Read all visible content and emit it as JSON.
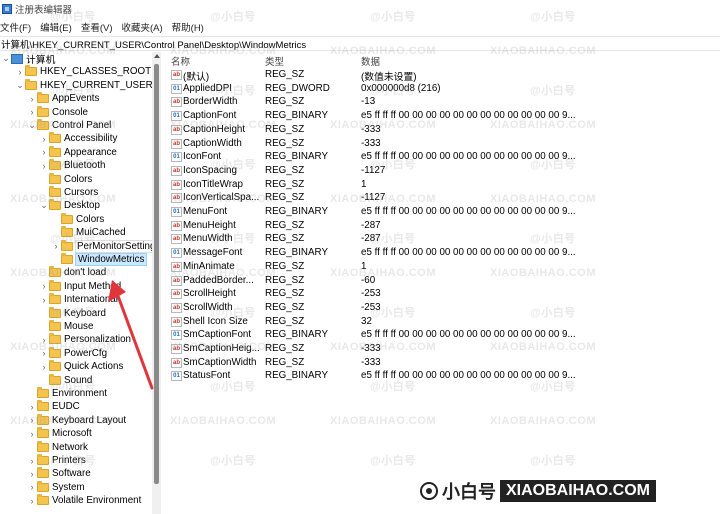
{
  "window": {
    "title": "注册表编辑器"
  },
  "menu": [
    "文件(F)",
    "编辑(E)",
    "查看(V)",
    "收藏夹(A)",
    "帮助(H)"
  ],
  "address": "计算机\\HKEY_CURRENT_USER\\Control Panel\\Desktop\\WindowMetrics",
  "tree": [
    {
      "label": "计算机",
      "indent": 0,
      "chev": "⌄",
      "icon": "computer"
    },
    {
      "label": "HKEY_CLASSES_ROOT",
      "indent": 1,
      "chev": "›",
      "icon": "folder"
    },
    {
      "label": "HKEY_CURRENT_USER",
      "indent": 1,
      "chev": "⌄",
      "icon": "folder"
    },
    {
      "label": "AppEvents",
      "indent": 2,
      "chev": "›",
      "icon": "folder"
    },
    {
      "label": "Console",
      "indent": 2,
      "chev": "›",
      "icon": "folder"
    },
    {
      "label": "Control Panel",
      "indent": 2,
      "chev": "⌄",
      "icon": "folder"
    },
    {
      "label": "Accessibility",
      "indent": 3,
      "chev": "›",
      "icon": "folder"
    },
    {
      "label": "Appearance",
      "indent": 3,
      "chev": "›",
      "icon": "folder"
    },
    {
      "label": "Bluetooth",
      "indent": 3,
      "chev": "›",
      "icon": "folder"
    },
    {
      "label": "Colors",
      "indent": 3,
      "chev": "",
      "icon": "folder"
    },
    {
      "label": "Cursors",
      "indent": 3,
      "chev": "",
      "icon": "folder"
    },
    {
      "label": "Desktop",
      "indent": 3,
      "chev": "⌄",
      "icon": "folder"
    },
    {
      "label": "Colors",
      "indent": 4,
      "chev": "",
      "icon": "folder"
    },
    {
      "label": "MuiCached",
      "indent": 4,
      "chev": "",
      "icon": "folder"
    },
    {
      "label": "PerMonitorSettings",
      "indent": 4,
      "chev": "›",
      "icon": "folder",
      "state": "highlight"
    },
    {
      "label": "WindowMetrics",
      "indent": 4,
      "chev": "",
      "icon": "folder",
      "state": "selected"
    },
    {
      "label": "don't load",
      "indent": 3,
      "chev": "",
      "icon": "folder"
    },
    {
      "label": "Input Method",
      "indent": 3,
      "chev": "›",
      "icon": "folder"
    },
    {
      "label": "International",
      "indent": 3,
      "chev": "›",
      "icon": "folder"
    },
    {
      "label": "Keyboard",
      "indent": 3,
      "chev": "",
      "icon": "folder"
    },
    {
      "label": "Mouse",
      "indent": 3,
      "chev": "",
      "icon": "folder"
    },
    {
      "label": "Personalization",
      "indent": 3,
      "chev": "›",
      "icon": "folder"
    },
    {
      "label": "PowerCfg",
      "indent": 3,
      "chev": "›",
      "icon": "folder"
    },
    {
      "label": "Quick Actions",
      "indent": 3,
      "chev": "›",
      "icon": "folder"
    },
    {
      "label": "Sound",
      "indent": 3,
      "chev": "",
      "icon": "folder"
    },
    {
      "label": "Environment",
      "indent": 2,
      "chev": "",
      "icon": "folder"
    },
    {
      "label": "EUDC",
      "indent": 2,
      "chev": "›",
      "icon": "folder"
    },
    {
      "label": "Keyboard Layout",
      "indent": 2,
      "chev": "›",
      "icon": "folder"
    },
    {
      "label": "Microsoft",
      "indent": 2,
      "chev": "›",
      "icon": "folder"
    },
    {
      "label": "Network",
      "indent": 2,
      "chev": "",
      "icon": "folder"
    },
    {
      "label": "Printers",
      "indent": 2,
      "chev": "›",
      "icon": "folder"
    },
    {
      "label": "Software",
      "indent": 2,
      "chev": "›",
      "icon": "folder"
    },
    {
      "label": "System",
      "indent": 2,
      "chev": "›",
      "icon": "folder"
    },
    {
      "label": "Volatile Environment",
      "indent": 2,
      "chev": "›",
      "icon": "folder"
    }
  ],
  "columns": {
    "name": "名称",
    "type": "类型",
    "data": "数据"
  },
  "values": [
    {
      "name": "(默认)",
      "type": "REG_SZ",
      "data": "(数值未设置)",
      "kind": "sz"
    },
    {
      "name": "AppliedDPI",
      "type": "REG_DWORD",
      "data": "0x000000d8 (216)",
      "kind": "bin"
    },
    {
      "name": "BorderWidth",
      "type": "REG_SZ",
      "data": "-13",
      "kind": "sz"
    },
    {
      "name": "CaptionFont",
      "type": "REG_BINARY",
      "data": "e5 ff ff ff 00 00 00 00 00 00 00 00 00 00 00 00 9...",
      "kind": "bin"
    },
    {
      "name": "CaptionHeight",
      "type": "REG_SZ",
      "data": "-333",
      "kind": "sz"
    },
    {
      "name": "CaptionWidth",
      "type": "REG_SZ",
      "data": "-333",
      "kind": "sz"
    },
    {
      "name": "IconFont",
      "type": "REG_BINARY",
      "data": "e5 ff ff ff 00 00 00 00 00 00 00 00 00 00 00 00 9...",
      "kind": "bin"
    },
    {
      "name": "IconSpacing",
      "type": "REG_SZ",
      "data": "-1127",
      "kind": "sz"
    },
    {
      "name": "IconTitleWrap",
      "type": "REG_SZ",
      "data": "1",
      "kind": "sz"
    },
    {
      "name": "IconVerticalSpa...",
      "type": "REG_SZ",
      "data": "-1127",
      "kind": "sz"
    },
    {
      "name": "MenuFont",
      "type": "REG_BINARY",
      "data": "e5 ff ff ff 00 00 00 00 00 00 00 00 00 00 00 00 9...",
      "kind": "bin"
    },
    {
      "name": "MenuHeight",
      "type": "REG_SZ",
      "data": "-287",
      "kind": "sz"
    },
    {
      "name": "MenuWidth",
      "type": "REG_SZ",
      "data": "-287",
      "kind": "sz"
    },
    {
      "name": "MessageFont",
      "type": "REG_BINARY",
      "data": "e5 ff ff ff 00 00 00 00 00 00 00 00 00 00 00 00 9...",
      "kind": "bin"
    },
    {
      "name": "MinAnimate",
      "type": "REG_SZ",
      "data": "1",
      "kind": "sz"
    },
    {
      "name": "PaddedBorder...",
      "type": "REG_SZ",
      "data": "-60",
      "kind": "sz"
    },
    {
      "name": "ScrollHeight",
      "type": "REG_SZ",
      "data": "-253",
      "kind": "sz"
    },
    {
      "name": "ScrollWidth",
      "type": "REG_SZ",
      "data": "-253",
      "kind": "sz"
    },
    {
      "name": "Shell Icon Size",
      "type": "REG_SZ",
      "data": "32",
      "kind": "sz"
    },
    {
      "name": "SmCaptionFont",
      "type": "REG_BINARY",
      "data": "e5 ff ff ff 00 00 00 00 00 00 00 00 00 00 00 00 9...",
      "kind": "bin"
    },
    {
      "name": "SmCaptionHeig...",
      "type": "REG_SZ",
      "data": "-333",
      "kind": "sz"
    },
    {
      "name": "SmCaptionWidth",
      "type": "REG_SZ",
      "data": "-333",
      "kind": "sz"
    },
    {
      "name": "StatusFont",
      "type": "REG_BINARY",
      "data": "e5 ff ff ff 00 00 00 00 00 00 00 00 00 00 00 00 9...",
      "kind": "bin"
    }
  ],
  "value_icon_text": {
    "sz": "ab",
    "bin": "01"
  },
  "watermarks": {
    "primary": "XIAOBAIHAO.COM",
    "secondary": "@小白号"
  },
  "brand": {
    "cn": "小白号",
    "en": "XIAOBAIHAO.COM"
  },
  "colors": {
    "selection": "#cce8ff",
    "arrow": "#e0353a",
    "folder": "#f5c44f"
  }
}
